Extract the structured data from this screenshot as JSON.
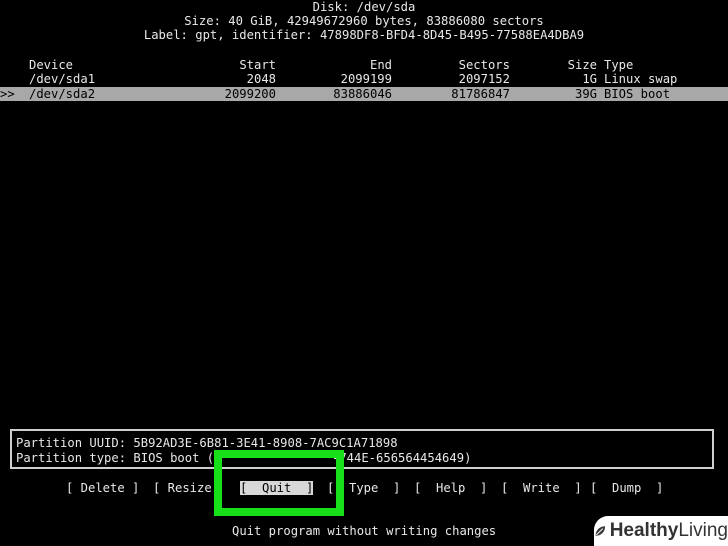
{
  "header": {
    "disk": "Disk: /dev/sda",
    "size": "Size: 40 GiB, 42949672960 bytes, 83886080 sectors",
    "label": "Label: gpt, identifier: 47898DF8-BFD4-8D45-B495-77588EA4DBA9"
  },
  "table": {
    "columns": [
      "Device",
      "Start",
      "End",
      "Sectors",
      "Size",
      "Type"
    ],
    "rows": [
      {
        "marker": "",
        "device": "/dev/sda1",
        "start": "2048",
        "end": "2099199",
        "sectors": "2097152",
        "size": "1G",
        "type": "Linux swap"
      },
      {
        "marker": ">>",
        "device": "/dev/sda2",
        "start": "2099200",
        "end": "83886046",
        "sectors": "81786847",
        "size": "39G",
        "type": "BIOS boot"
      }
    ]
  },
  "info": {
    "uuid": "Partition UUID: 5B92AD3E-6B81-3E41-8908-7AC9C1A71898",
    "type_prefix": "Partition type: BIOS boot (2",
    "type_suffix": "-744E-656564454649)"
  },
  "menu": {
    "delete": "[ Delete ]",
    "resize": "[ Resize",
    "quit": "[  Quit  ]",
    "type": "[  Type  ]",
    "help": "[  Help  ]",
    "write": "[  Write  ]",
    "dump": "[  Dump  ]"
  },
  "status": "Quit program without writing changes",
  "watermark": {
    "brand": "Healthy",
    "suffix": " Living"
  },
  "colors": {
    "highlight": "#17e01a",
    "selection": "#a8a8a8"
  }
}
